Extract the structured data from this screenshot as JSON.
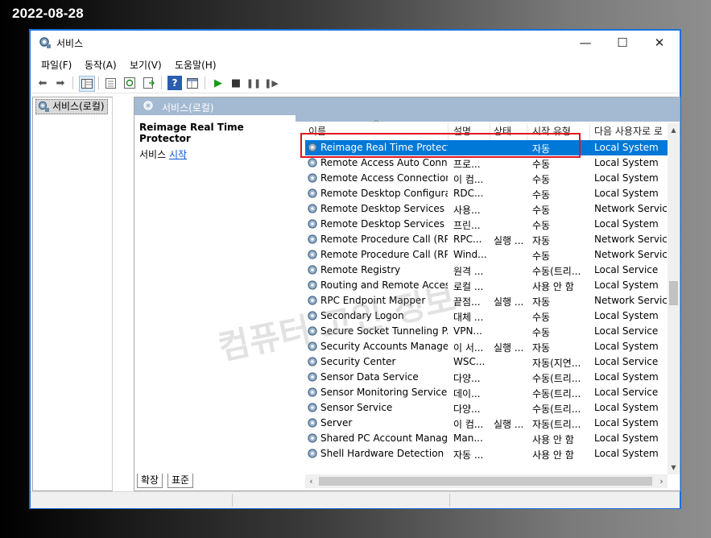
{
  "date_stamp": "2022-08-28",
  "window": {
    "title": "서비스",
    "minimize": "—",
    "maximize": "☐",
    "close": "✕"
  },
  "menu": [
    "파일(F)",
    "동작(A)",
    "보기(V)",
    "도움말(H)"
  ],
  "tree": {
    "root_label": "서비스(로컬)"
  },
  "pane": {
    "header": "서비스(로컬)",
    "selected_service_name": "Reimage Real Time Protector",
    "action_prefix": "서비스 ",
    "action_link": "시작"
  },
  "columns": [
    "이름",
    "설명",
    "상태",
    "시작 유형",
    "다음 사용자로 로"
  ],
  "services": [
    {
      "name": "Reimage Real Time Protector",
      "desc": "",
      "status": "",
      "startup": "자동",
      "logon": "Local System",
      "selected": true
    },
    {
      "name": "Remote Access Auto Conn...",
      "desc": "프로...",
      "status": "",
      "startup": "수동",
      "logon": "Local System"
    },
    {
      "name": "Remote Access Connection...",
      "desc": "이 컴...",
      "status": "",
      "startup": "수동",
      "logon": "Local System"
    },
    {
      "name": "Remote Desktop Configura...",
      "desc": "RDC...",
      "status": "",
      "startup": "수동",
      "logon": "Local System"
    },
    {
      "name": "Remote Desktop Services",
      "desc": "사용...",
      "status": "",
      "startup": "수동",
      "logon": "Network Service"
    },
    {
      "name": "Remote Desktop Services ...",
      "desc": "프린...",
      "status": "",
      "startup": "수동",
      "logon": "Local System"
    },
    {
      "name": "Remote Procedure Call (RP...",
      "desc": "RPC...",
      "status": "실행 ...",
      "startup": "자동",
      "logon": "Network Service"
    },
    {
      "name": "Remote Procedure Call (RP...",
      "desc": "Wind...",
      "status": "",
      "startup": "수동",
      "logon": "Network Service"
    },
    {
      "name": "Remote Registry",
      "desc": "원격 ...",
      "status": "",
      "startup": "수동(트리...",
      "logon": "Local Service"
    },
    {
      "name": "Routing and Remote Access",
      "desc": "로컬 ...",
      "status": "",
      "startup": "사용 안 함",
      "logon": "Local System"
    },
    {
      "name": "RPC Endpoint Mapper",
      "desc": "끝점...",
      "status": "실행 ...",
      "startup": "자동",
      "logon": "Network Service"
    },
    {
      "name": "Secondary Logon",
      "desc": "대체 ...",
      "status": "",
      "startup": "수동",
      "logon": "Local System"
    },
    {
      "name": "Secure Socket Tunneling P...",
      "desc": "VPN...",
      "status": "",
      "startup": "수동",
      "logon": "Local Service"
    },
    {
      "name": "Security Accounts Manager",
      "desc": "이 서...",
      "status": "실행 ...",
      "startup": "자동",
      "logon": "Local System"
    },
    {
      "name": "Security Center",
      "desc": "WSC...",
      "status": "",
      "startup": "자동(지연...",
      "logon": "Local Service"
    },
    {
      "name": "Sensor Data Service",
      "desc": "다양...",
      "status": "",
      "startup": "수동(트리...",
      "logon": "Local System"
    },
    {
      "name": "Sensor Monitoring Service",
      "desc": "데이...",
      "status": "",
      "startup": "수동(트리...",
      "logon": "Local Service"
    },
    {
      "name": "Sensor Service",
      "desc": "다양...",
      "status": "",
      "startup": "수동(트리...",
      "logon": "Local System"
    },
    {
      "name": "Server",
      "desc": "이 컴...",
      "status": "실행 ...",
      "startup": "자동(트리...",
      "logon": "Local System"
    },
    {
      "name": "Shared PC Account Manager",
      "desc": "Man...",
      "status": "",
      "startup": "사용 안 함",
      "logon": "Local System"
    },
    {
      "name": "Shell Hardware Detection",
      "desc": "자동 ...",
      "status": "",
      "startup": "사용 안 함",
      "logon": "Local System"
    }
  ],
  "bottom_tabs": [
    "확장",
    "표준"
  ],
  "watermark": "컴퓨터 고인 정보",
  "colors": {
    "selection": "#0078d7",
    "highlight_border": "#e0141e",
    "pane_header": "#a4b9d2",
    "window_border": "#1a73d9"
  }
}
